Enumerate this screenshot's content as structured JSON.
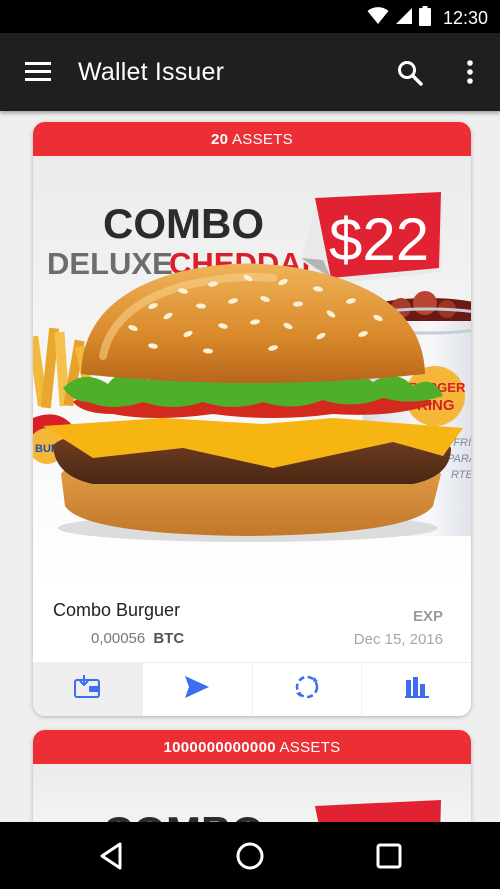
{
  "status_bar": {
    "time": "12:30",
    "icons": [
      "wifi-icon",
      "signal-icon",
      "battery-icon"
    ]
  },
  "app_bar": {
    "title": "Wallet Issuer",
    "icons": [
      "menu-icon",
      "search-icon",
      "more-vert-icon"
    ]
  },
  "colors": {
    "accent": "#ec2f35",
    "action_blue": "#3d6df0",
    "app_bar": "#1f1f1f"
  },
  "cards": [
    {
      "assets_count": "20",
      "assets_label": "ASSETS",
      "promo": {
        "line1": "COMBO",
        "line2a": "DELUXE",
        "line2b": "CHEDDAR",
        "price": "$22",
        "brand": "BURGER KING",
        "cup_text": "EN FRÍA A PARA RTE"
      },
      "name": "Combo Burguer",
      "amount": "0,00056",
      "currency": "BTC",
      "exp_label": "EXP",
      "exp_date": "Dec 15, 2016",
      "actions": [
        "wallet-receive-icon",
        "send-icon",
        "exchange-icon",
        "stats-icon"
      ]
    },
    {
      "assets_count": "1000000000000",
      "assets_label": "ASSETS",
      "promo": {
        "line1": "COMBO"
      }
    }
  ],
  "nav_bar": {
    "icons": [
      "back-icon",
      "home-icon",
      "recents-icon"
    ]
  }
}
